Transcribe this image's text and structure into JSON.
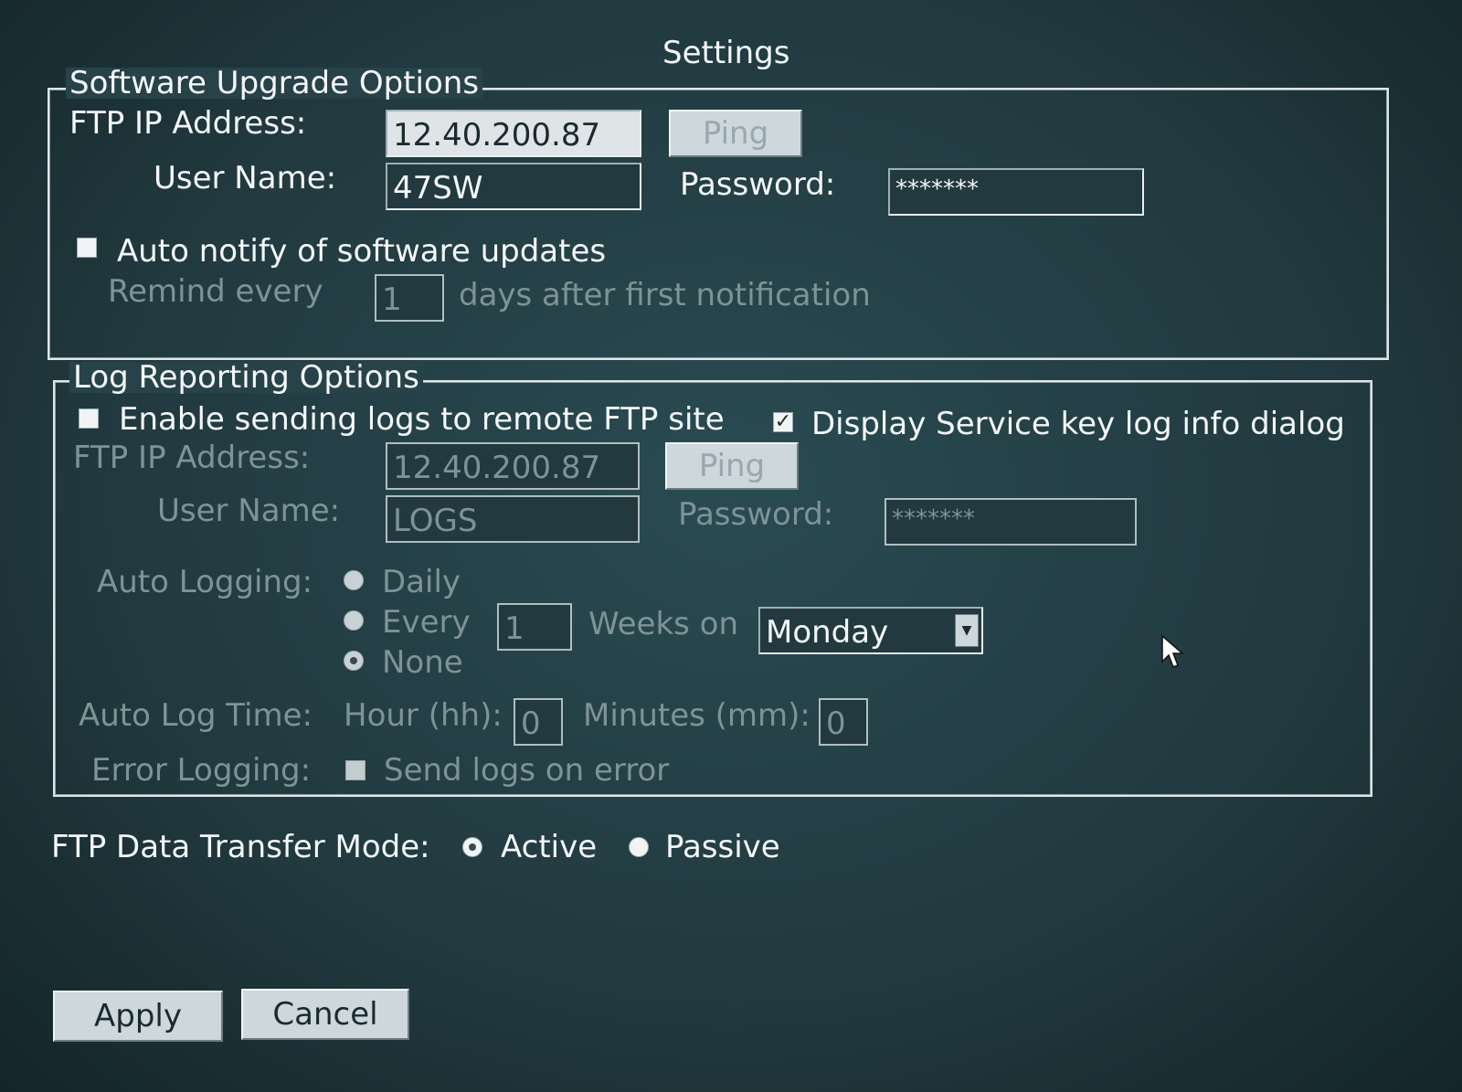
{
  "window": {
    "title": "Settings"
  },
  "software_upgrade": {
    "legend": "Software Upgrade Options",
    "ftp_ip_label": "FTP IP Address:",
    "ftp_ip_value": "12.40.200.87",
    "ping_label": "Ping",
    "user_name_label": "User Name:",
    "user_name_value": "47SW",
    "password_label": "Password:",
    "password_value": "*******",
    "auto_notify_label": "Auto notify of software updates",
    "auto_notify_checked": false,
    "remind_prefix": "Remind every",
    "remind_value": "1",
    "remind_suffix": "days after first notification"
  },
  "log_reporting": {
    "legend": "Log Reporting Options",
    "enable_label": "Enable sending logs to remote FTP site",
    "enable_checked": false,
    "display_service_label": "Display Service key log info dialog",
    "display_service_checked": true,
    "ftp_ip_label": "FTP IP Address:",
    "ftp_ip_value": "12.40.200.87",
    "ping_label": "Ping",
    "user_name_label": "User Name:",
    "user_name_value": "LOGS",
    "password_label": "Password:",
    "password_value": "*******",
    "auto_logging_label": "Auto Logging:",
    "options": {
      "daily": "Daily",
      "every": "Every",
      "none": "None"
    },
    "selected_option": "None",
    "weeks_value": "1",
    "weeks_on_label": "Weeks on",
    "day_value": "Monday",
    "auto_log_time_label": "Auto Log Time:",
    "hour_label": "Hour (hh):",
    "hour_value": "0",
    "minutes_label": "Minutes (mm):",
    "minutes_value": "0",
    "error_logging_label": "Error Logging:",
    "send_on_error_label": "Send logs on error",
    "send_on_error_checked": false
  },
  "transfer_mode": {
    "label": "FTP Data Transfer Mode:",
    "active_label": "Active",
    "passive_label": "Passive",
    "selected": "Active"
  },
  "footer": {
    "apply_label": "Apply",
    "cancel_label": "Cancel"
  },
  "icons": {
    "check": "✓",
    "dropdown": "▼"
  },
  "colors": {
    "background": "#21393f",
    "text": "#f4f7f8",
    "disabled_text": "#7e9396",
    "button": "#cdd7dc"
  }
}
